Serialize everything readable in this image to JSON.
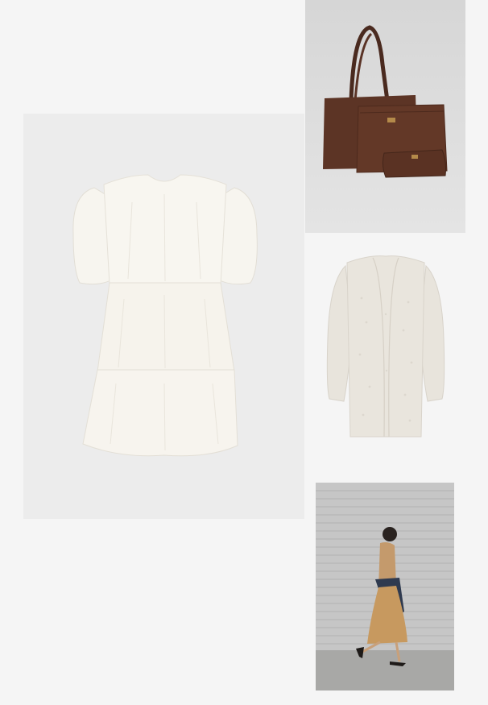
{
  "collage": {
    "background": "#f5f5f5",
    "items": [
      {
        "name": "white-tiered-dress",
        "icon": "dress-icon",
        "color": "#f4f1ea"
      },
      {
        "name": "brown-leather-bag-set",
        "icon": "bag-icon",
        "color": "#5e3526"
      },
      {
        "name": "cream-knit-cardigan",
        "icon": "cardigan-icon",
        "color": "#e6e2da"
      },
      {
        "name": "model-walking",
        "icon": "person-icon",
        "color": "#c49a6c"
      }
    ]
  }
}
